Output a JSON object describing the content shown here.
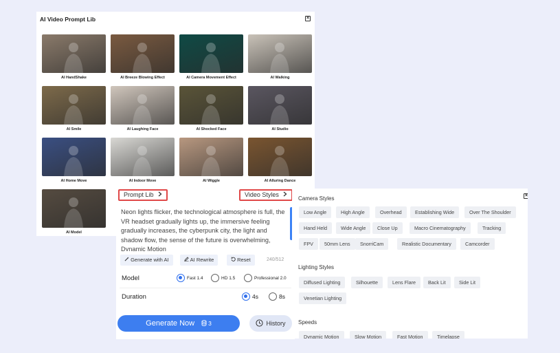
{
  "lib": {
    "title": "AI Video Prompt Lib",
    "close": "×",
    "items": [
      {
        "label": "AI HandShake",
        "icon": "photo-couple",
        "color": "#8a7a6a"
      },
      {
        "label": "AI Breeze Blowing Effect",
        "icon": "photo-portrait",
        "color": "#7a5a40"
      },
      {
        "label": "AI Camera Movement Effect",
        "icon": "photo-dress",
        "color": "#0f4a45"
      },
      {
        "label": "AI Walking",
        "icon": "photo-walking",
        "color": "#c9c2b8"
      },
      {
        "label": "AI Smile",
        "icon": "photo-smile",
        "color": "#7d6a4a"
      },
      {
        "label": "AI Laughing Face",
        "icon": "photo-laughing",
        "color": "#d0c6bc"
      },
      {
        "label": "AI Shocked Face",
        "icon": "photo-shocked",
        "color": "#5a5438"
      },
      {
        "label": "AI Studio",
        "icon": "photo-studio",
        "color": "#5a5660"
      },
      {
        "label": "AI Home Move",
        "icon": "photo-house",
        "color": "#3a4f82"
      },
      {
        "label": "AI Indoor Move",
        "icon": "photo-kitchen",
        "color": "#d9d8d4"
      },
      {
        "label": "AI Wiggle",
        "icon": "photo-wiggle",
        "color": "#b89880"
      },
      {
        "label": "AI Alluring Dance",
        "icon": "photo-dance",
        "color": "#7a5530"
      },
      {
        "label": "AI Model",
        "icon": "photo-model",
        "color": "#554b40"
      }
    ]
  },
  "editor": {
    "prompt_lib_label": "Prompt Lib",
    "video_styles_label": "Video Styles",
    "prompt_text": "Neon lights flicker, the technological atmosphere is full, the VR headset gradually lights up, the immersive feeling gradually increases, the cyberpunk city, the light and shadow flow, the sense of the future is overwhelming, Dynamic Motion",
    "tools": {
      "generate_ai": "Generate with AI",
      "rewrite": "AI Rewrite",
      "reset": "Reset"
    },
    "counter": "240/512",
    "model_label": "Model",
    "model_options": [
      "Fast 1.4",
      "HD 1.5",
      "Professional 2.0"
    ],
    "model_selected": "Fast 1.4",
    "duration_label": "Duration",
    "duration_options": [
      "4s",
      "8s"
    ],
    "duration_selected": "4s",
    "generate_label": "Generate Now",
    "credits": "3",
    "history_label": "History",
    "colors": {
      "accent": "#3d7ef0",
      "highlight": "#e04848"
    }
  },
  "styles": {
    "close": "×",
    "camera_title": "Camera Styles",
    "camera": [
      "Low Angle",
      "High Angle",
      "Overhead",
      "Establishing Wide",
      "Over The Shoulder",
      "Hand Held",
      "Wide Angle",
      "Close Up",
      "Macro Cinematography",
      "Tracking",
      "FPV",
      "50mm Lens",
      "SnorriCam",
      "Realistic Documentary",
      "Camcorder"
    ],
    "lighting_title": "Lighting Styles",
    "lighting": [
      "Diffused Lighting",
      "Silhouette",
      "Lens Flare",
      "Back Lit",
      "Side Lit",
      "Venetian Lighting"
    ],
    "speeds_title": "Speeds",
    "speeds": [
      "Dynamic Motion",
      "Slow Motion",
      "Fast Motion",
      "Timelapse"
    ]
  }
}
